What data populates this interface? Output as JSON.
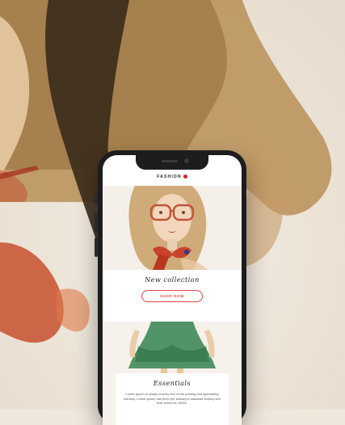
{
  "brand": {
    "logo_text": "FASHION",
    "accent": "#d4232a"
  },
  "hero": {
    "title": "New collection",
    "button": "SHOP NOW"
  },
  "essentials": {
    "title": "Essentials",
    "body": "Lorem Ipsum is simply dummy text of the printing and typesetting industry. Lorem Ipsum has been the industry's standard dummy text ever since the 1500s."
  },
  "colors": {
    "button_border": "#e24646",
    "phone_frame": "#1d1d1f",
    "screen_bg": "#ffffff"
  }
}
